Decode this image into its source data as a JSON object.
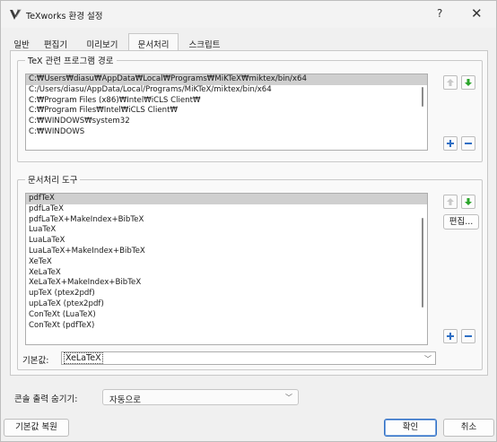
{
  "window": {
    "title": "TeXworks 환경 설정",
    "help": "?",
    "close": "✕"
  },
  "tabs": [
    {
      "label": "일반"
    },
    {
      "label": "편집기"
    },
    {
      "label": "미리보기"
    },
    {
      "label": "문서처리"
    },
    {
      "label": "스크립트"
    }
  ],
  "active_tab": "문서처리",
  "paths_group": {
    "title": "TeX 관련 프로그램 경로",
    "items": [
      "C:₩Users₩diasu₩AppData₩Local₩Programs₩MiKTeX₩miktex/bin/x64",
      "C:/Users/diasu/AppData/Local/Programs/MiKTeX/miktex/bin/x64",
      "C:₩Program Files (x86)₩Intel₩iCLS Client₩",
      "C:₩Program Files₩Intel₩iCLS Client₩",
      "C:₩WINDOWS₩system32",
      "C:₩WINDOWS"
    ],
    "selected_index": 0
  },
  "tools_group": {
    "title": "문서처리 도구",
    "items": [
      "pdfTeX",
      "pdfLaTeX",
      "pdfLaTeX+MakeIndex+BibTeX",
      "LuaTeX",
      "LuaLaTeX",
      "LuaLaTeX+MakeIndex+BibTeX",
      "XeTeX",
      "XeLaTeX",
      "XeLaTeX+MakeIndex+BibTeX",
      "upTeX (ptex2pdf)",
      "upLaTeX (ptex2pdf)",
      "ConTeXt (LuaTeX)",
      "ConTeXt (pdfTeX)"
    ],
    "selected_index": 0,
    "edit_label": "편집...",
    "default_label": "기본값:",
    "default_value": "XeLaTeX"
  },
  "console": {
    "label": "콘솔 출력 숨기기:",
    "value": "자동으로"
  },
  "buttons": {
    "restore_defaults": "기본값 복원",
    "ok": "확인",
    "cancel": "취소"
  },
  "colors": {
    "up_arrow": "#c9c9c9",
    "down_arrow": "#2aa52a",
    "plus_minus": "#2f6fc4",
    "primary_border": "#2f6fc4"
  }
}
